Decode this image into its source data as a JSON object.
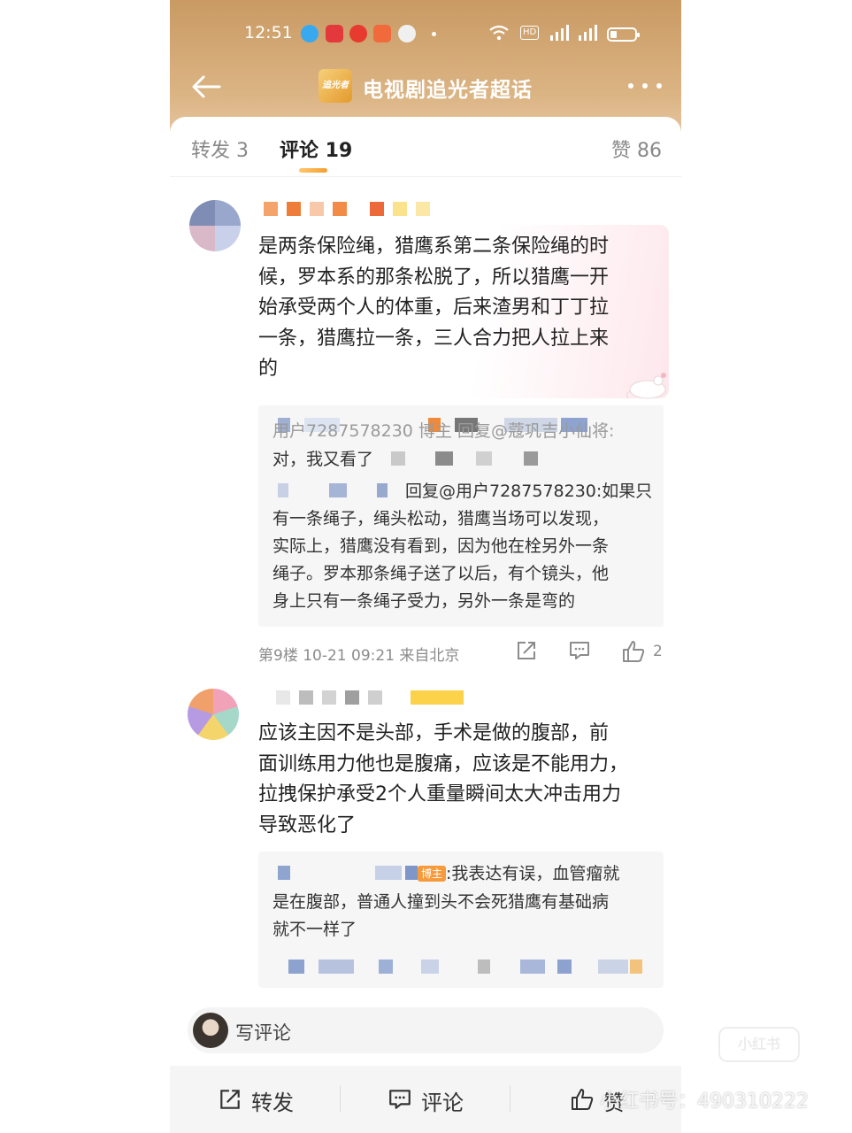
{
  "status_bar": {
    "time": "12:51",
    "hd_label": "HD",
    "notif_icons": [
      "qq-icon",
      "app-icon",
      "weibo-icon",
      "message-icon",
      "wechat-icon"
    ]
  },
  "nav": {
    "logo_text": "追光者",
    "title": "电视剧追光者超话"
  },
  "tabs": {
    "forward": "转发 3",
    "comment": "评论 19",
    "like": "赞 86"
  },
  "comments": [
    {
      "text_lines": [
        "是两条保险绳，猎鹰系第二条保险绳的时",
        "候，罗本系的那条松脱了，所以猎鹰一开",
        "始承受两个人的体重，后来渣男和丁丁拉",
        "一条，猎鹰拉一条，三人合力把人拉上来",
        "的"
      ],
      "replies": [
        "用户7287578230 博主 回复@蔻巩吉小仙将:",
        "对，我又看了",
        "回复@用户7287578230:如果只",
        "有一条绳子，绳头松动，猎鹰当场可以发现，",
        "实际上，猎鹰没有看到，因为他在栓另外一条",
        "绳子。罗本那条绳子送了以后，有个镜头，他",
        "身上只有一条绳子受力，另外一条是弯的"
      ],
      "meta": "第9楼 10-21 09:21 来自北京",
      "like_count": "2"
    },
    {
      "text_lines": [
        "应该主因不是头部，手术是做的腹部，前",
        "面训练用力他也是腹痛，应该是不能用力，",
        "拉拽保护承受2个人重量瞬间太大冲击用力",
        "导致恶化了"
      ],
      "host_badge": "博主",
      "replies": [
        ":我表达有误，血管瘤就",
        "是在腹部，普通人撞到头不会死猎鹰有基础病",
        "就不一样了"
      ]
    }
  ],
  "write_comment": "写评论",
  "bottom_bar": {
    "forward": "转发",
    "comment": "评论",
    "like": "赞"
  },
  "watermark": {
    "text": "小红书号：490310222",
    "logo": "小红书"
  },
  "colors": {
    "header_top": "#c99a63",
    "header_bottom": "#efd9bd",
    "accent": "#f59e33",
    "host_badge": "#f79a3b"
  }
}
